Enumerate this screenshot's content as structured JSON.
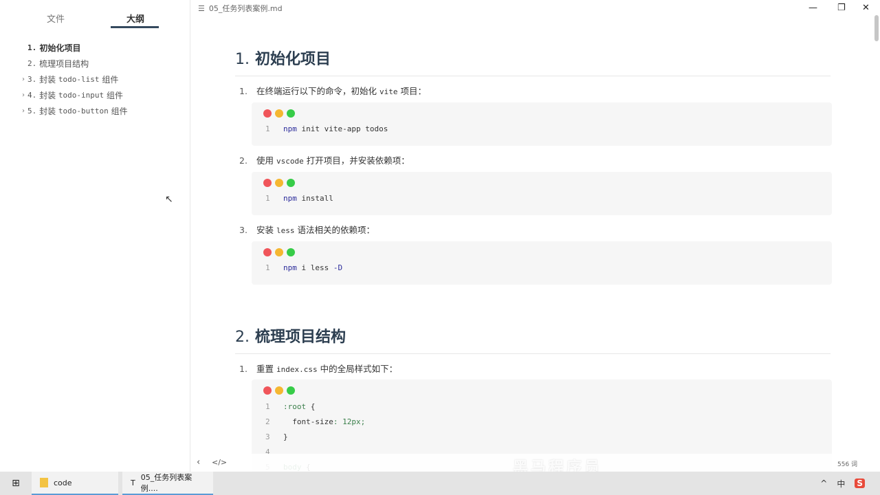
{
  "sidebar": {
    "tabs": [
      "文件",
      "大纲"
    ],
    "outline": [
      {
        "num": "1.",
        "text": "初始化项目",
        "collapsible": false,
        "bold": true
      },
      {
        "num": "2.",
        "text": "梳理项目结构",
        "collapsible": false
      },
      {
        "num": "3.",
        "pre": "封装",
        "code": "todo-list",
        "post": "组件",
        "collapsible": true
      },
      {
        "num": "4.",
        "pre": "封装",
        "code": "todo-input",
        "post": "组件",
        "collapsible": true
      },
      {
        "num": "5.",
        "pre": "封装",
        "code": "todo-button",
        "post": "组件",
        "collapsible": true
      }
    ]
  },
  "window": {
    "title": "05_任务列表案例.md"
  },
  "doc": {
    "h1a": {
      "num": "1.",
      "text": "初始化项目"
    },
    "step1": {
      "n": "1.",
      "pre": "在终端运行以下的命令，初始化",
      "code": "vite",
      "post": "项目："
    },
    "code1": {
      "ln": "1",
      "kw": "npm",
      "rest": "init vite-app todos"
    },
    "step2": {
      "n": "2.",
      "pre": "使用",
      "code": "vscode",
      "post": "打开项目，并安装依赖项："
    },
    "code2": {
      "ln": "1",
      "kw": "npm",
      "rest": "install"
    },
    "step3": {
      "n": "3.",
      "pre": "安装",
      "code": "less",
      "post": "语法相关的依赖项："
    },
    "code3": {
      "ln": "1",
      "kw": "npm",
      "rest": "i less",
      "flag": "-D"
    },
    "h1b": {
      "num": "2.",
      "text": "梳理项目结构"
    },
    "step4": {
      "n": "1.",
      "pre": "重置",
      "code": "index.css",
      "post": "中的全局样式如下："
    },
    "code4": [
      {
        "ln": "1",
        "sel": ":root",
        "rest": " {"
      },
      {
        "ln": "2",
        "prop": "  font-size",
        "val": ": 12px;"
      },
      {
        "ln": "3",
        "rest": "}"
      },
      {
        "ln": "4",
        "rest": ""
      },
      {
        "ln": "5",
        "sel": "body",
        "rest": " {"
      }
    ]
  },
  "status": {
    "word_count": "556 词"
  },
  "watermark": "黑马程序员",
  "taskbar": {
    "items": [
      "code",
      "05_任务列表案例...."
    ]
  },
  "colors": {
    "red": "#f0555a",
    "yellow": "#f5b731",
    "green": "#37cc48",
    "heading": "#2c3e50"
  }
}
